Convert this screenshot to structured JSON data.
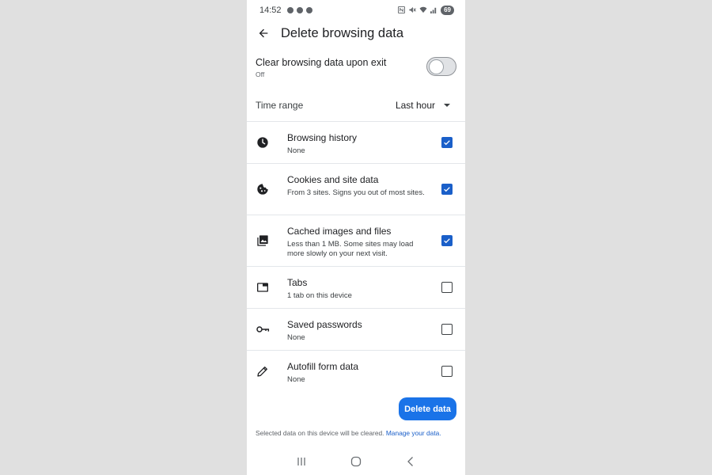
{
  "status_bar": {
    "time": "14:52",
    "battery": "69",
    "left_icons": [
      "snapchat-icon",
      "messenger-icon",
      "chat-icon"
    ],
    "right_icons": [
      "nfc-icon",
      "mute-icon",
      "wifi-icon",
      "signal-icon"
    ]
  },
  "header": {
    "title": "Delete browsing data"
  },
  "clear_on_exit": {
    "label": "Clear browsing data upon exit",
    "state": "Off",
    "enabled": false
  },
  "time_range": {
    "label": "Time range",
    "value": "Last hour"
  },
  "items": [
    {
      "icon": "clock-icon",
      "title": "Browsing history",
      "subtitle": "None",
      "checked": true
    },
    {
      "icon": "cookie-icon",
      "title": "Cookies and site data",
      "subtitle": "From 3 sites. Signs you out of most sites.",
      "checked": true
    },
    {
      "icon": "image-icon",
      "title": "Cached images and files",
      "subtitle": "Less than 1 MB. Some sites may load more slowly on your next visit.",
      "checked": true
    },
    {
      "icon": "tab-icon",
      "title": "Tabs",
      "subtitle": "1 tab on this device",
      "checked": false
    },
    {
      "icon": "key-icon",
      "title": "Saved passwords",
      "subtitle": "None",
      "checked": false
    },
    {
      "icon": "pencil-icon",
      "title": "Autofill form data",
      "subtitle": "None",
      "checked": false
    }
  ],
  "delete_button": {
    "label": "Delete data"
  },
  "footer": {
    "text": "Selected data on this device will be cleared.",
    "link": "Manage your data."
  },
  "colors": {
    "accent": "#1a73e8",
    "checkbox": "#1a5fc9",
    "background": "#e0e0e0"
  }
}
